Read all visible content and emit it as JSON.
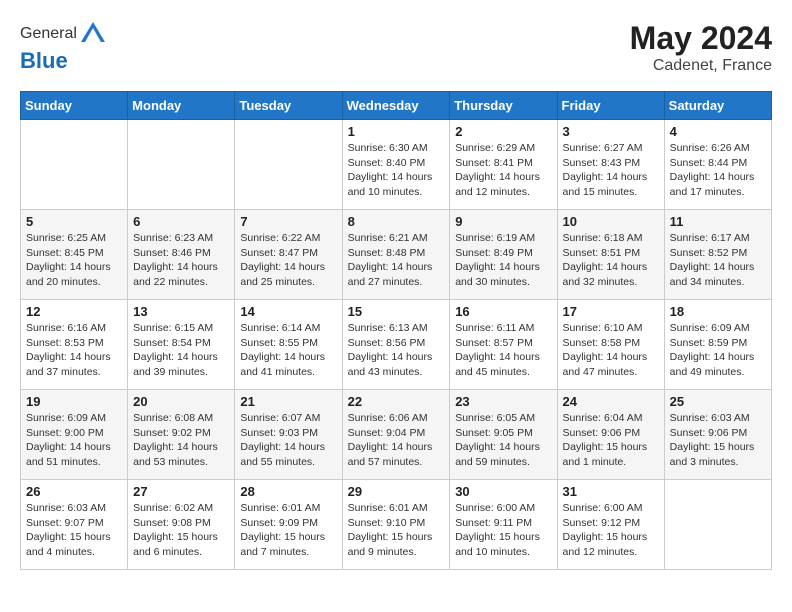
{
  "header": {
    "logo_general": "General",
    "logo_blue": "Blue",
    "month_year": "May 2024",
    "location": "Cadenet, France"
  },
  "days_of_week": [
    "Sunday",
    "Monday",
    "Tuesday",
    "Wednesday",
    "Thursday",
    "Friday",
    "Saturday"
  ],
  "weeks": [
    [
      {
        "day": "",
        "info": ""
      },
      {
        "day": "",
        "info": ""
      },
      {
        "day": "",
        "info": ""
      },
      {
        "day": "1",
        "info": "Sunrise: 6:30 AM\nSunset: 8:40 PM\nDaylight: 14 hours\nand 10 minutes."
      },
      {
        "day": "2",
        "info": "Sunrise: 6:29 AM\nSunset: 8:41 PM\nDaylight: 14 hours\nand 12 minutes."
      },
      {
        "day": "3",
        "info": "Sunrise: 6:27 AM\nSunset: 8:43 PM\nDaylight: 14 hours\nand 15 minutes."
      },
      {
        "day": "4",
        "info": "Sunrise: 6:26 AM\nSunset: 8:44 PM\nDaylight: 14 hours\nand 17 minutes."
      }
    ],
    [
      {
        "day": "5",
        "info": "Sunrise: 6:25 AM\nSunset: 8:45 PM\nDaylight: 14 hours\nand 20 minutes."
      },
      {
        "day": "6",
        "info": "Sunrise: 6:23 AM\nSunset: 8:46 PM\nDaylight: 14 hours\nand 22 minutes."
      },
      {
        "day": "7",
        "info": "Sunrise: 6:22 AM\nSunset: 8:47 PM\nDaylight: 14 hours\nand 25 minutes."
      },
      {
        "day": "8",
        "info": "Sunrise: 6:21 AM\nSunset: 8:48 PM\nDaylight: 14 hours\nand 27 minutes."
      },
      {
        "day": "9",
        "info": "Sunrise: 6:19 AM\nSunset: 8:49 PM\nDaylight: 14 hours\nand 30 minutes."
      },
      {
        "day": "10",
        "info": "Sunrise: 6:18 AM\nSunset: 8:51 PM\nDaylight: 14 hours\nand 32 minutes."
      },
      {
        "day": "11",
        "info": "Sunrise: 6:17 AM\nSunset: 8:52 PM\nDaylight: 14 hours\nand 34 minutes."
      }
    ],
    [
      {
        "day": "12",
        "info": "Sunrise: 6:16 AM\nSunset: 8:53 PM\nDaylight: 14 hours\nand 37 minutes."
      },
      {
        "day": "13",
        "info": "Sunrise: 6:15 AM\nSunset: 8:54 PM\nDaylight: 14 hours\nand 39 minutes."
      },
      {
        "day": "14",
        "info": "Sunrise: 6:14 AM\nSunset: 8:55 PM\nDaylight: 14 hours\nand 41 minutes."
      },
      {
        "day": "15",
        "info": "Sunrise: 6:13 AM\nSunset: 8:56 PM\nDaylight: 14 hours\nand 43 minutes."
      },
      {
        "day": "16",
        "info": "Sunrise: 6:11 AM\nSunset: 8:57 PM\nDaylight: 14 hours\nand 45 minutes."
      },
      {
        "day": "17",
        "info": "Sunrise: 6:10 AM\nSunset: 8:58 PM\nDaylight: 14 hours\nand 47 minutes."
      },
      {
        "day": "18",
        "info": "Sunrise: 6:09 AM\nSunset: 8:59 PM\nDaylight: 14 hours\nand 49 minutes."
      }
    ],
    [
      {
        "day": "19",
        "info": "Sunrise: 6:09 AM\nSunset: 9:00 PM\nDaylight: 14 hours\nand 51 minutes."
      },
      {
        "day": "20",
        "info": "Sunrise: 6:08 AM\nSunset: 9:02 PM\nDaylight: 14 hours\nand 53 minutes."
      },
      {
        "day": "21",
        "info": "Sunrise: 6:07 AM\nSunset: 9:03 PM\nDaylight: 14 hours\nand 55 minutes."
      },
      {
        "day": "22",
        "info": "Sunrise: 6:06 AM\nSunset: 9:04 PM\nDaylight: 14 hours\nand 57 minutes."
      },
      {
        "day": "23",
        "info": "Sunrise: 6:05 AM\nSunset: 9:05 PM\nDaylight: 14 hours\nand 59 minutes."
      },
      {
        "day": "24",
        "info": "Sunrise: 6:04 AM\nSunset: 9:06 PM\nDaylight: 15 hours\nand 1 minute."
      },
      {
        "day": "25",
        "info": "Sunrise: 6:03 AM\nSunset: 9:06 PM\nDaylight: 15 hours\nand 3 minutes."
      }
    ],
    [
      {
        "day": "26",
        "info": "Sunrise: 6:03 AM\nSunset: 9:07 PM\nDaylight: 15 hours\nand 4 minutes."
      },
      {
        "day": "27",
        "info": "Sunrise: 6:02 AM\nSunset: 9:08 PM\nDaylight: 15 hours\nand 6 minutes."
      },
      {
        "day": "28",
        "info": "Sunrise: 6:01 AM\nSunset: 9:09 PM\nDaylight: 15 hours\nand 7 minutes."
      },
      {
        "day": "29",
        "info": "Sunrise: 6:01 AM\nSunset: 9:10 PM\nDaylight: 15 hours\nand 9 minutes."
      },
      {
        "day": "30",
        "info": "Sunrise: 6:00 AM\nSunset: 9:11 PM\nDaylight: 15 hours\nand 10 minutes."
      },
      {
        "day": "31",
        "info": "Sunrise: 6:00 AM\nSunset: 9:12 PM\nDaylight: 15 hours\nand 12 minutes."
      },
      {
        "day": "",
        "info": ""
      }
    ]
  ]
}
